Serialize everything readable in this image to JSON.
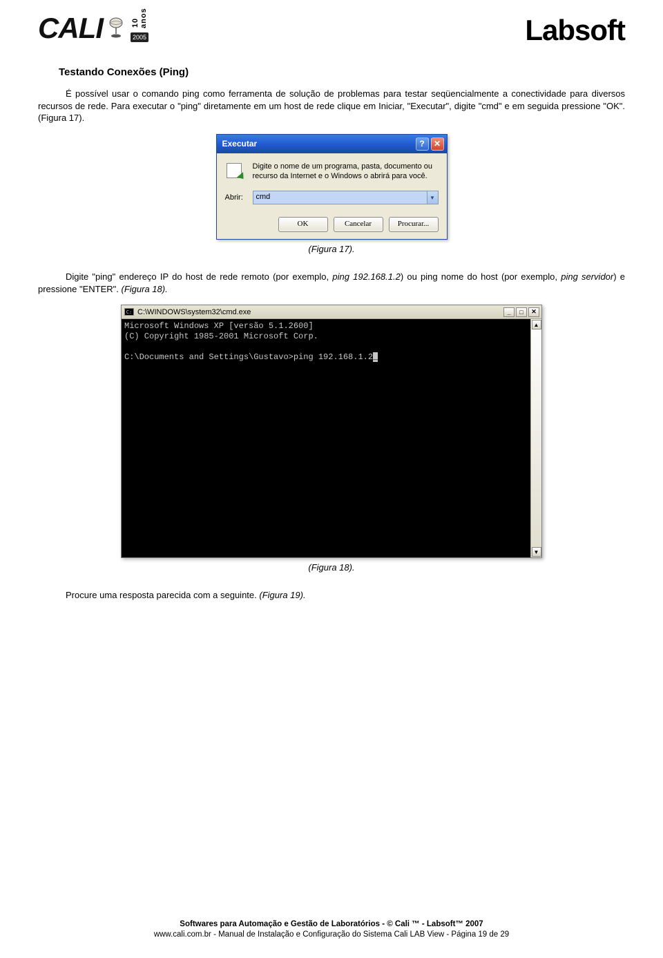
{
  "header": {
    "brand_left": "CALI",
    "badge_text": "10 anos",
    "badge_year": "2005",
    "brand_right": "Labsoft"
  },
  "section": {
    "title": "Testando Conexões (Ping)",
    "para1": "É possível usar o comando ping como ferramenta de solução de problemas para testar seqüencialmente a conectividade para diversos recursos de rede. Para executar o \"ping\" diretamente em um host de rede clique em Iniciar, \"Executar\", digite \"cmd\" e em seguida pressione \"OK\". (Figura 17).",
    "caption17": "(Figura 17).",
    "para2_pre": "Digite \"ping\" endereço IP do host de rede remoto (por exemplo, ",
    "para2_ex1": "ping 192.168.1.2",
    "para2_mid": ") ou ping nome do host (por exemplo, ",
    "para2_ex2": "ping servidor",
    "para2_post": ") e pressione \"ENTER\". ",
    "para2_fig": "(Figura 18).",
    "caption18": "(Figura 18).",
    "para3_pre": "Procure uma resposta parecida com a seguinte. ",
    "para3_fig": "(Figura 19)."
  },
  "run_dialog": {
    "title": "Executar",
    "description": "Digite o nome de um programa, pasta, documento ou recurso da Internet e o Windows o abrirá para você.",
    "open_label": "Abrir:",
    "open_value": "cmd",
    "btn_ok": "OK",
    "btn_cancel": "Cancelar",
    "btn_browse": "Procurar..."
  },
  "cmd_window": {
    "title": "C:\\WINDOWS\\system32\\cmd.exe",
    "line1": "Microsoft Windows XP [versão 5.1.2600]",
    "line2": "(C) Copyright 1985-2001 Microsoft Corp.",
    "prompt": "C:\\Documents and Settings\\Gustavo>ping 192.168.1.2"
  },
  "footer": {
    "line1": "Softwares para Automação e Gestão de Laboratórios - © Cali ™ - Labsoft™ 2007",
    "line2": "www.cali.com.br - Manual de Instalação e Configuração do Sistema Cali LAB View - Página 19 de 29"
  }
}
